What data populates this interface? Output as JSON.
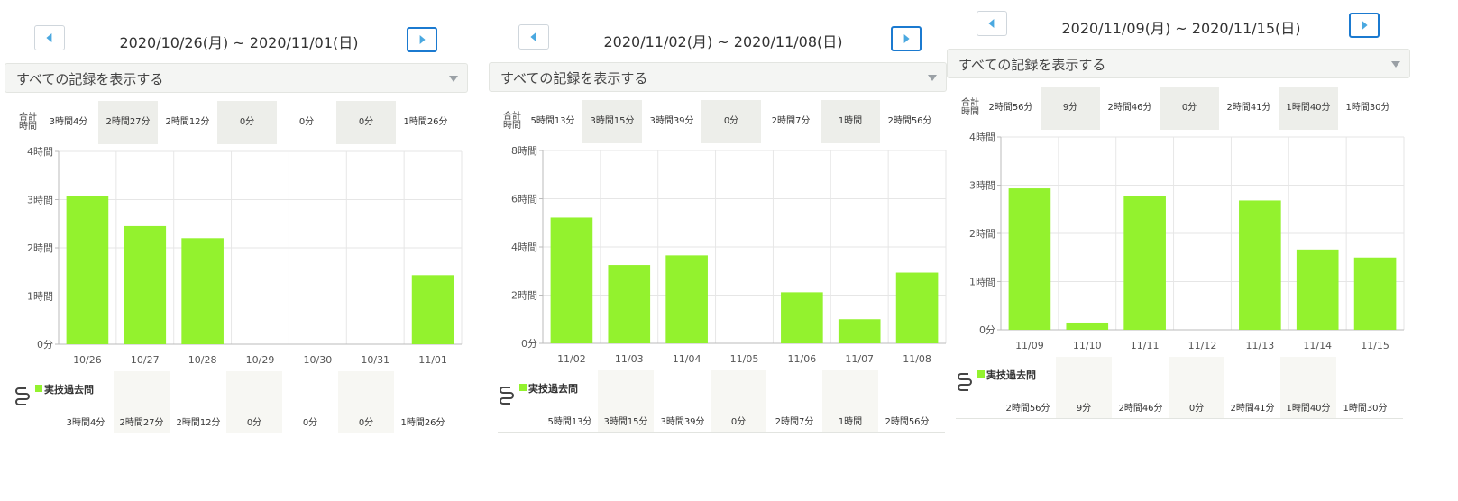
{
  "panels": [
    {
      "period": "2020/10/26(月) ~ 2020/11/01(日)",
      "filter": "すべての記録を表示する",
      "totals_label": "合計時間",
      "totals": [
        "3時間4分",
        "2時間27分",
        "2時間12分",
        "0分",
        "0分",
        "0分",
        "1時間26分"
      ],
      "legend": "実技過去問",
      "breakdown": [
        "3時間4分",
        "2時間27分",
        "2時間12分",
        "0分",
        "0分",
        "0分",
        "1時間26分"
      ],
      "chart_data": {
        "type": "bar",
        "categories": [
          "10/26",
          "10/27",
          "10/28",
          "10/29",
          "10/30",
          "10/31",
          "11/01"
        ],
        "values": [
          184,
          147,
          132,
          0,
          0,
          0,
          86
        ],
        "unit": "minutes",
        "ylim": [
          0,
          240
        ],
        "yticks": [
          0,
          60,
          120,
          180,
          240
        ],
        "ytick_labels": [
          "0分",
          "1時間",
          "2時間",
          "3時間",
          "4時間"
        ],
        "color": "#93f22e"
      }
    },
    {
      "period": "2020/11/02(月) ~ 2020/11/08(日)",
      "filter": "すべての記録を表示する",
      "totals_label": "合計時間",
      "totals": [
        "5時間13分",
        "3時間15分",
        "3時間39分",
        "0分",
        "2時間7分",
        "1時間",
        "2時間56分"
      ],
      "legend": "実技過去問",
      "breakdown": [
        "5時間13分",
        "3時間15分",
        "3時間39分",
        "0分",
        "2時間7分",
        "1時間",
        "2時間56分"
      ],
      "chart_data": {
        "type": "bar",
        "categories": [
          "11/02",
          "11/03",
          "11/04",
          "11/05",
          "11/06",
          "11/07",
          "11/08"
        ],
        "values": [
          313,
          195,
          219,
          0,
          127,
          60,
          176
        ],
        "unit": "minutes",
        "ylim": [
          0,
          480
        ],
        "yticks": [
          0,
          120,
          240,
          360,
          480
        ],
        "ytick_labels": [
          "0分",
          "2時間",
          "4時間",
          "6時間",
          "8時間"
        ],
        "color": "#93f22e"
      }
    },
    {
      "period": "2020/11/09(月) ~ 2020/11/15(日)",
      "filter": "すべての記録を表示する",
      "totals_label": "合計時間",
      "totals": [
        "2時間56分",
        "9分",
        "2時間46分",
        "0分",
        "2時間41分",
        "1時間40分",
        "1時間30分"
      ],
      "legend": "実技過去問",
      "breakdown": [
        "2時間56分",
        "9分",
        "2時間46分",
        "0分",
        "2時間41分",
        "1時間40分",
        "1時間30分"
      ],
      "chart_data": {
        "type": "bar",
        "categories": [
          "11/09",
          "11/10",
          "11/11",
          "11/12",
          "11/13",
          "11/14",
          "11/15"
        ],
        "values": [
          176,
          9,
          166,
          0,
          161,
          100,
          90
        ],
        "unit": "minutes",
        "ylim": [
          0,
          240
        ],
        "yticks": [
          0,
          60,
          120,
          180,
          240
        ],
        "ytick_labels": [
          "0分",
          "1時間",
          "2時間",
          "3時間",
          "4時間"
        ],
        "color": "#93f22e"
      }
    }
  ]
}
